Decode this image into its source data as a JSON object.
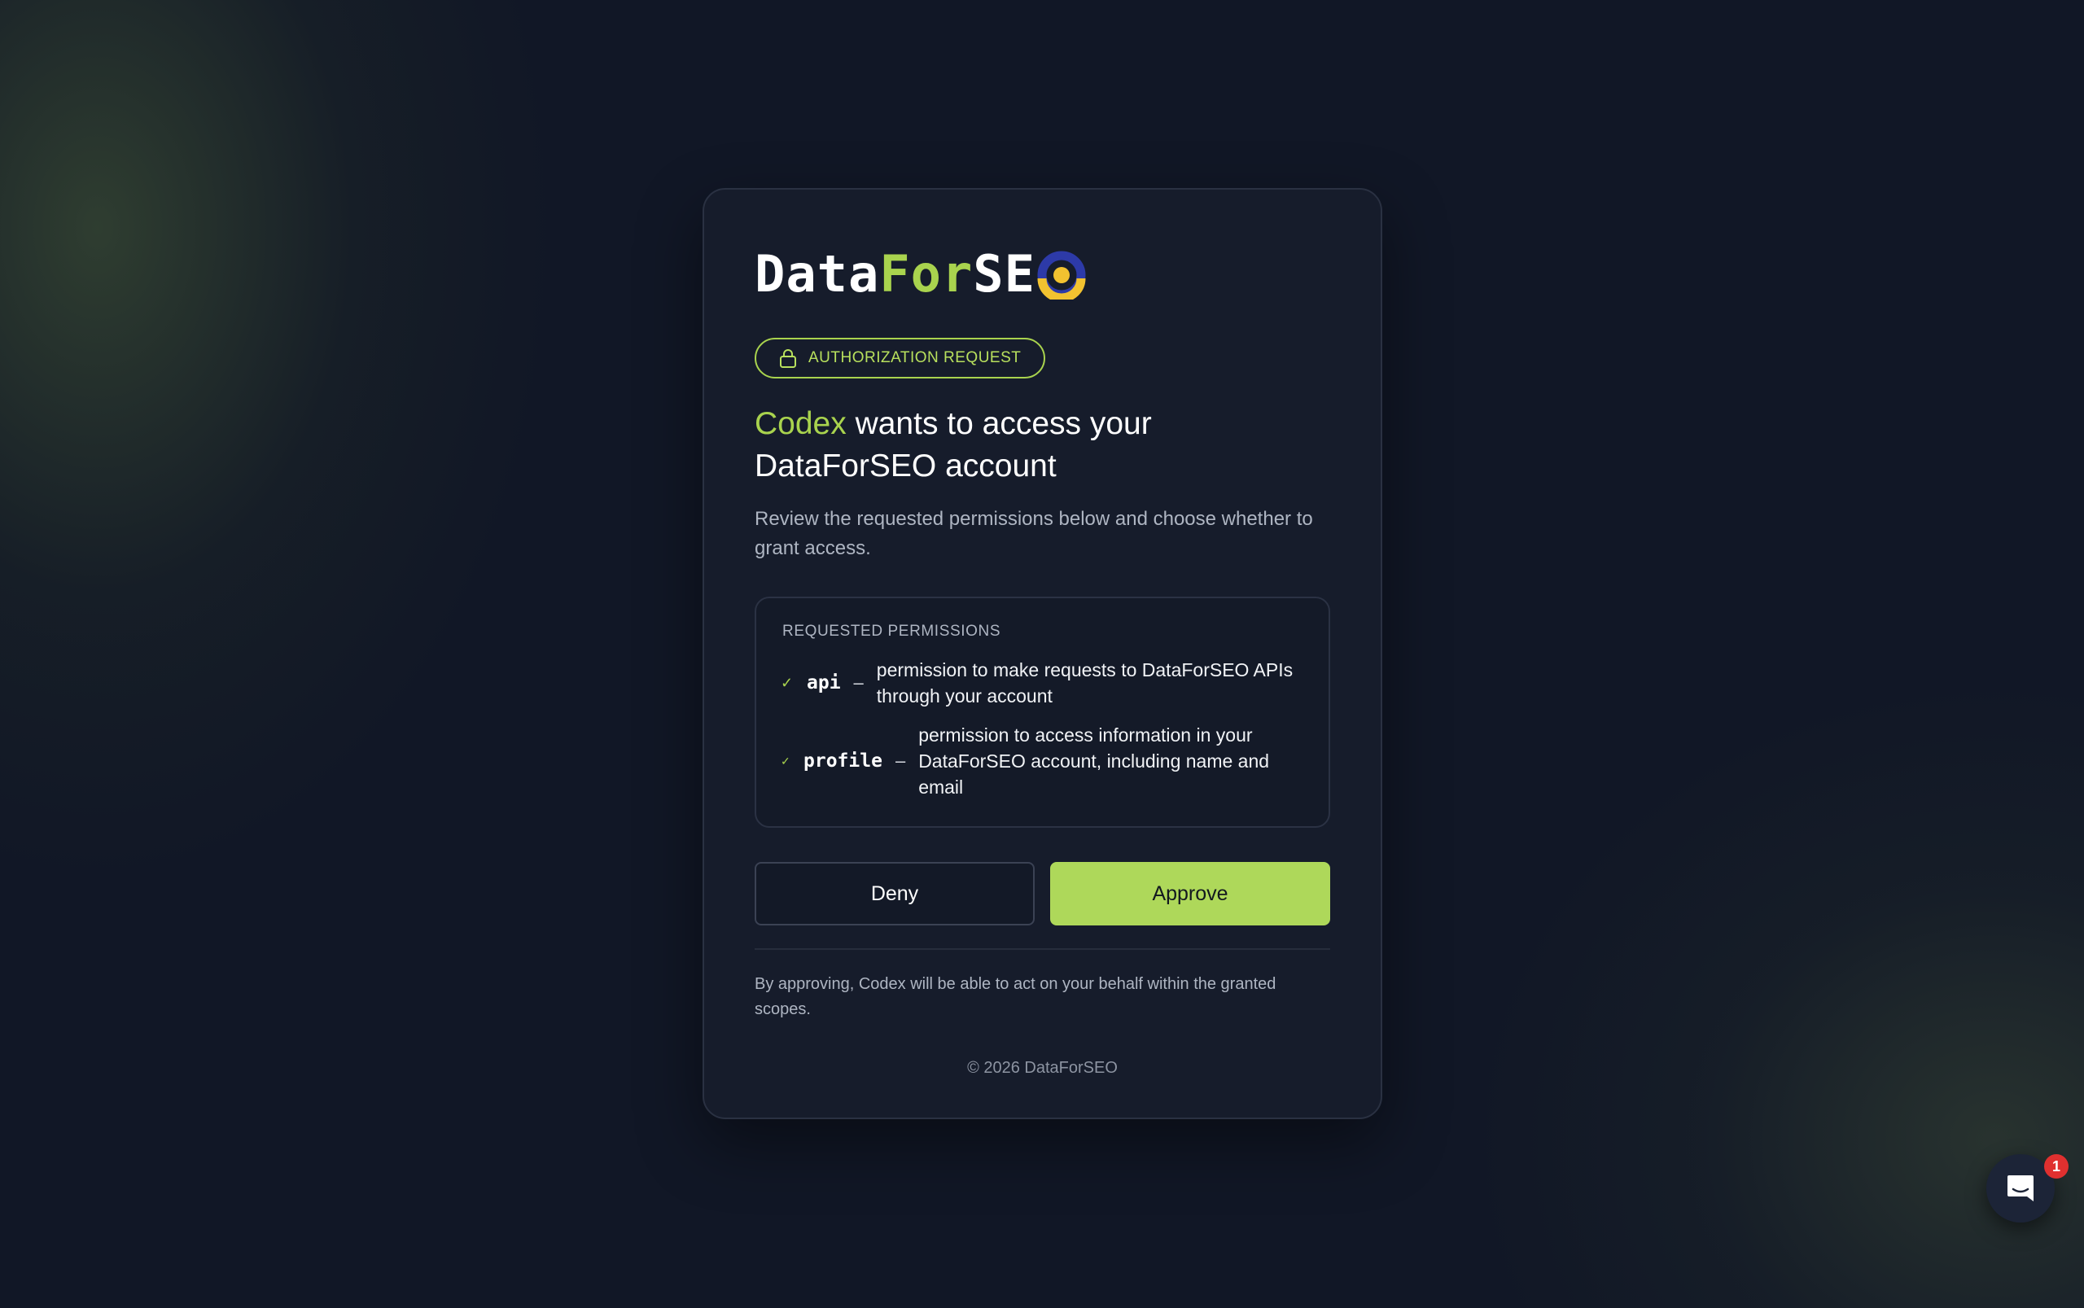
{
  "logo": {
    "part1": "Data",
    "part2": "For",
    "part3": "SE"
  },
  "badge": {
    "label": "AUTHORIZATION REQUEST"
  },
  "heading": {
    "app_name": "Codex",
    "rest": " wants to access your DataForSEO account"
  },
  "subtitle": "Review the requested permissions below and choose whether to grant access.",
  "permissions": {
    "title": "REQUESTED PERMISSIONS",
    "items": [
      {
        "scope": "api",
        "separator": "–",
        "description": "permission to make requests to DataForSEO APIs through your account"
      },
      {
        "scope": "profile",
        "separator": "–",
        "description": "permission to access information in your DataForSEO account, including name and email"
      }
    ]
  },
  "buttons": {
    "deny": "Deny",
    "approve": "Approve"
  },
  "note": "By approving, Codex will be able to act on your behalf within the granted scopes.",
  "copyright": "© 2026 DataForSEO",
  "chat_widget": {
    "unread_count": "1"
  },
  "colors": {
    "accent": "#a9d34e",
    "background": "#111726",
    "card": "#161c2b",
    "badge_red": "#e0302f"
  }
}
